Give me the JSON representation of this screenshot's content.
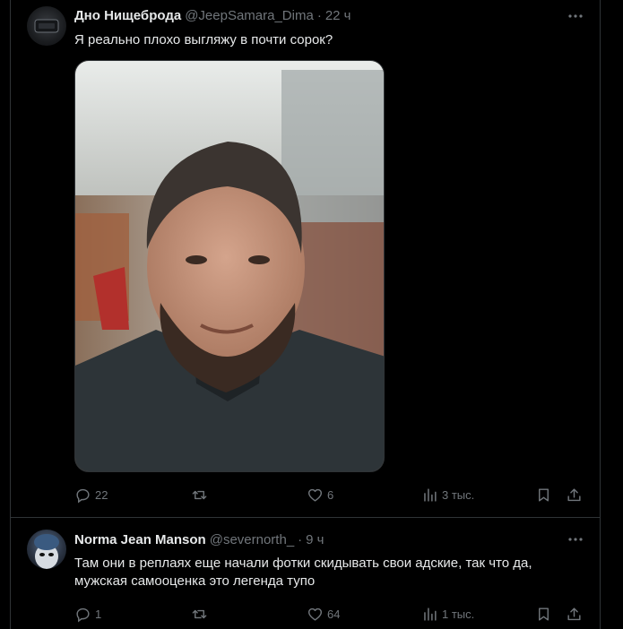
{
  "tweets": [
    {
      "author_name": "Дно Нищеброда",
      "author_handle": "@JeepSamara_Dima",
      "separator": "·",
      "time": "22 ч",
      "text": "Я реально плохо выгляжу в почти сорок?",
      "stats": {
        "replies": "22",
        "retweets": "",
        "likes": "6",
        "views": "3 тыс."
      }
    },
    {
      "author_name": "Norma Jean Manson",
      "author_handle": "@severnorth_",
      "separator": "·",
      "time": "9 ч",
      "text": "Там они в реплаях еще начали фотки скидывать свои адские, так что да, мужская самооценка это легенда тупо",
      "stats": {
        "replies": "1",
        "retweets": "",
        "likes": "64",
        "views": "1 тыс."
      }
    }
  ],
  "icons": {
    "more": "more-horizontal-icon",
    "reply": "reply-icon",
    "retweet": "retweet-icon",
    "like": "heart-icon",
    "views": "views-icon",
    "bookmark": "bookmark-icon",
    "share": "share-icon"
  },
  "colors": {
    "background": "#000000",
    "text_primary": "#e7e9ea",
    "text_secondary": "#71767b",
    "border": "#2f3336"
  }
}
